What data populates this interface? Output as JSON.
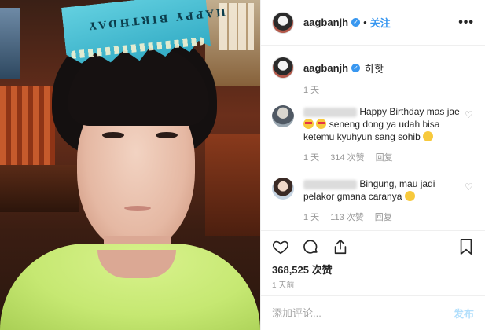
{
  "post": {
    "username": "aagbanjh",
    "follow_label": "关注",
    "more_label": "•••",
    "caption": "하핫",
    "caption_time": "1 天",
    "likes": "368,525 次赞",
    "time_ago": "1 天前",
    "comment_placeholder": "添加评论...",
    "post_label": "发布",
    "photo_crown_text": "HAPPY BIRTHDAY"
  },
  "comments": [
    {
      "text_line1": "Happy Birthday mas jae",
      "text_line2": "seneng dong ya udah bisa",
      "text_line3": "ketemu kyuhyun sang sohib",
      "time": "1 天",
      "likes": "314 次赞",
      "reply": "回复"
    },
    {
      "text_line1": "Bingung, mau jadi",
      "text_line2": "pelakor gmana caranya",
      "time": "1 天",
      "likes": "113 次赞",
      "reply": "回复"
    }
  ],
  "icons": {
    "verified": "verified-badge-icon",
    "like": "heart-icon",
    "comment": "comment-bubble-icon",
    "share": "share-icon",
    "save": "bookmark-icon"
  },
  "colors": {
    "accent": "#3897f0",
    "muted": "#999999",
    "post_disabled": "#b2dffc"
  }
}
